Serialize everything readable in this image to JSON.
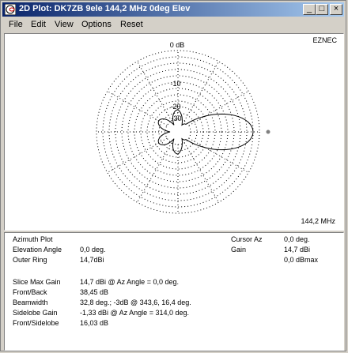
{
  "window": {
    "title": "2D Plot: DK7ZB 9ele 144,2 MHz 0deg Elev",
    "icon": "polar-plot-icon",
    "minimize_label": "_",
    "maximize_label": "□",
    "close_label": "×"
  },
  "menu": [
    "File",
    "Edit",
    "View",
    "Options",
    "Reset"
  ],
  "plot": {
    "program": "EZNEC",
    "frequency": "144,2 MHz",
    "ring_labels": [
      "0 dB",
      "-10",
      "-20",
      "-30"
    ],
    "colors": {
      "grid": "#000000",
      "pattern": "#000000",
      "cursor": "#808080"
    }
  },
  "info": {
    "plot_type": "Azimuth Plot",
    "elevation_label": "Elevation Angle",
    "elevation_value": "0,0 deg.",
    "outer_ring_label": "Outer Ring",
    "outer_ring_value": "14,7dBi",
    "cursor_az_label": "Cursor Az",
    "cursor_az_value": "0,0 deg.",
    "gain_label": "Gain",
    "gain_value": "14,7 dBi",
    "gain_dbmax": "0,0 dBmax",
    "rows": [
      {
        "label": "Slice Max Gain",
        "value": "14,7 dBi @ Az Angle = 0,0 deg."
      },
      {
        "label": "Front/Back",
        "value": "38,45 dB"
      },
      {
        "label": "Beamwidth",
        "value": "32,8 deg.; -3dB @ 343,6, 16,4 deg."
      },
      {
        "label": "Sidelobe Gain",
        "value": "-1,33 dBi @ Az Angle = 314,0 deg."
      },
      {
        "label": "Front/Sidelobe",
        "value": "16,03 dB"
      }
    ]
  }
}
